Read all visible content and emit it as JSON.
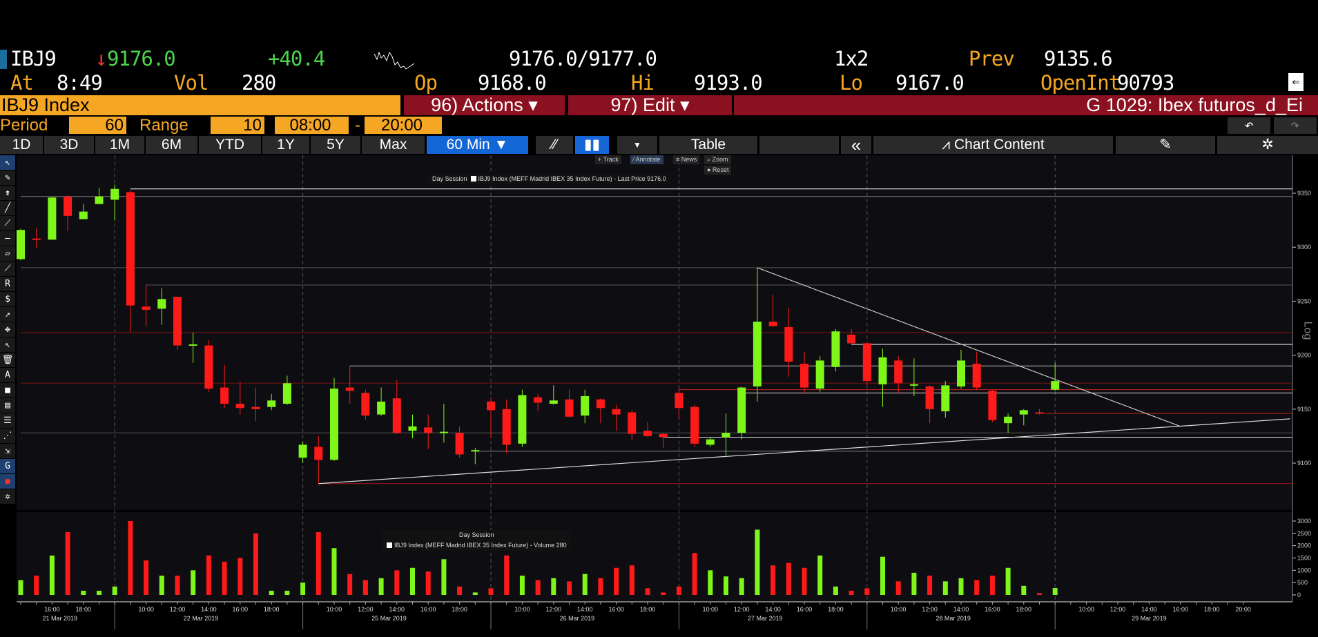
{
  "quote": {
    "ticker": "IBJ9",
    "arrow": "↓",
    "last": "9176.0",
    "change": "+40.4",
    "bid_ask": "9176.0/9177.0",
    "size": "1x2",
    "prev_label": "Prev",
    "prev": "9135.6",
    "at_label": "At",
    "time": "8:49",
    "vol_label": "Vol",
    "vol": "280",
    "op_label": "Op",
    "op": "9168.0",
    "hi_label": "Hi",
    "hi": "9193.0",
    "lo_label": "Lo",
    "lo": "9167.0",
    "oi_label": "OpenInt",
    "oi": "90793"
  },
  "bar": {
    "security": "IBJ9 Index",
    "actions": "96) Actions ▾",
    "edit": "97) Edit ▾",
    "title": "G 1029: Ibex futuros_d_Ei"
  },
  "params": {
    "period_label": "Period",
    "period": "60",
    "range_label": "Range",
    "range": "10",
    "start": "08:00",
    "dash": "-",
    "end": "20:00"
  },
  "toolbar": {
    "ranges": [
      "1D",
      "3D",
      "1M",
      "6M",
      "YTD",
      "1Y",
      "5Y",
      "Max"
    ],
    "interval": "60 Min ▼",
    "table": "Table",
    "collapse": "«",
    "chart_content": "Chart Content"
  },
  "chart_tools": {
    "track": "+ Track",
    "annotate": "⁄ Annotate",
    "news": "≡ News",
    "zoom": "⌕ Zoom",
    "reset": "● Reset"
  },
  "chart_data": {
    "type": "candlestick",
    "legend": {
      "session": "Day Session",
      "series": "IBJ9 Index (MEFF Madrid IBEX 35 Index Future) - Last Price 9176.0"
    },
    "volume_legend": {
      "session": "Day Session",
      "series": "IBJ9 Index (MEFF Madrid IBEX 35 Index Future) - Volume 280"
    },
    "y_axis_label": "Log",
    "ylim": [
      9060,
      9365
    ],
    "y_ticks": [
      "9350",
      "9300",
      "9250",
      "9200",
      "9150",
      "9100"
    ],
    "volume_ticks": [
      "3000",
      "2500",
      "2000",
      "1500",
      "1000",
      "500",
      "0"
    ],
    "colors": {
      "up": "#7ef61a",
      "down": "#ff1a1a"
    },
    "days": [
      {
        "date": "21 Mar 2019",
        "start": 0,
        "first_hour": 14,
        "count": 6,
        "labels": [
          "16:00",
          "18:00"
        ]
      },
      {
        "date": "22 Mar 2019",
        "start": 6,
        "first_hour": 8,
        "count": 12,
        "labels": [
          "10:00",
          "12:00",
          "14:00",
          "16:00",
          "18:00"
        ]
      },
      {
        "date": "25 Mar 2019",
        "start": 18,
        "first_hour": 8,
        "count": 12,
        "labels": [
          "10:00",
          "12:00",
          "14:00",
          "16:00",
          "18:00"
        ]
      },
      {
        "date": "26 Mar 2019",
        "start": 30,
        "first_hour": 8,
        "count": 12,
        "labels": [
          "10:00",
          "12:00",
          "14:00",
          "16:00",
          "18:00"
        ]
      },
      {
        "date": "27 Mar 2019",
        "start": 42,
        "first_hour": 8,
        "count": 12,
        "labels": [
          "10:00",
          "12:00",
          "14:00",
          "16:00",
          "18:00"
        ]
      },
      {
        "date": "28 Mar 2019",
        "start": 54,
        "first_hour": 8,
        "count": 12,
        "labels": [
          "10:00",
          "12:00",
          "14:00",
          "16:00",
          "18:00"
        ]
      },
      {
        "date": "29 Mar 2019",
        "start": 66,
        "first_hour": 8,
        "count": 13,
        "labels": [
          "10:00",
          "12:00",
          "14:00",
          "16:00",
          "18:00",
          "20:00"
        ]
      }
    ],
    "ohlc": [
      [
        9289,
        9317,
        9288,
        9316
      ],
      [
        9308,
        9318,
        9299,
        9307
      ],
      [
        9307,
        9347,
        9307,
        9346
      ],
      [
        9347,
        9348,
        9315,
        9329
      ],
      [
        9326,
        9340,
        9326,
        9333
      ],
      [
        9340,
        9355,
        9340,
        9347
      ],
      [
        9344,
        9358,
        9325,
        9354
      ],
      [
        9351,
        9353,
        9221,
        9246
      ],
      [
        9245,
        9265,
        9227,
        9242
      ],
      [
        9243,
        9262,
        9228,
        9252
      ],
      [
        9254,
        9254,
        9205,
        9209
      ],
      [
        9209,
        9221,
        9193,
        9210
      ],
      [
        9209,
        9214,
        9166,
        9169
      ],
      [
        9170,
        9191,
        9151,
        9155
      ],
      [
        9155,
        9175,
        9145,
        9151
      ],
      [
        9152,
        9170,
        9139,
        9150
      ],
      [
        9152,
        9164,
        9149,
        9158
      ],
      [
        9155,
        9181,
        9154,
        9174
      ],
      [
        9105,
        9120,
        9100,
        9117
      ],
      [
        9115,
        9125,
        9081,
        9103
      ],
      [
        9103,
        9179,
        9102,
        9169
      ],
      [
        9170,
        9190,
        9155,
        9167
      ],
      [
        9165,
        9168,
        9140,
        9144
      ],
      [
        9145,
        9170,
        9144,
        9157
      ],
      [
        9160,
        9177,
        9127,
        9128
      ],
      [
        9130,
        9145,
        9123,
        9134
      ],
      [
        9133,
        9145,
        9113,
        9128
      ],
      [
        9128,
        9155,
        9119,
        9129
      ],
      [
        9128,
        9134,
        9105,
        9108
      ],
      [
        9112,
        9114,
        9099,
        9112
      ],
      [
        9157,
        9160,
        9123,
        9149
      ],
      [
        9150,
        9159,
        9109,
        9117
      ],
      [
        9118,
        9168,
        9115,
        9163
      ],
      [
        9161,
        9164,
        9148,
        9156
      ],
      [
        9155,
        9172,
        9154,
        9158
      ],
      [
        9159,
        9168,
        9142,
        9143
      ],
      [
        9144,
        9168,
        9137,
        9162
      ],
      [
        9159,
        9160,
        9137,
        9151
      ],
      [
        9150,
        9154,
        9130,
        9145
      ],
      [
        9147,
        9149,
        9121,
        9127
      ],
      [
        9130,
        9138,
        9124,
        9125
      ],
      [
        9127,
        9128,
        9114,
        9124
      ],
      [
        9165,
        9170,
        9140,
        9151
      ],
      [
        9152,
        9154,
        9115,
        9118
      ],
      [
        9117,
        9124,
        9115,
        9122
      ],
      [
        9124,
        9146,
        9107,
        9128
      ],
      [
        9128,
        9171,
        9122,
        9170
      ],
      [
        9171,
        9281,
        9157,
        9231
      ],
      [
        9231,
        9256,
        9226,
        9227
      ],
      [
        9226,
        9244,
        9180,
        9194
      ],
      [
        9192,
        9203,
        9164,
        9170
      ],
      [
        9169,
        9199,
        9166,
        9195
      ],
      [
        9189,
        9224,
        9185,
        9222
      ],
      [
        9219,
        9224,
        9210,
        9211
      ],
      [
        9211,
        9212,
        9172,
        9176
      ],
      [
        9173,
        9206,
        9152,
        9198
      ],
      [
        9195,
        9199,
        9165,
        9174
      ],
      [
        9172,
        9197,
        9162,
        9173
      ],
      [
        9171,
        9172,
        9137,
        9150
      ],
      [
        9148,
        9176,
        9142,
        9172
      ],
      [
        9171,
        9205,
        9169,
        9195
      ],
      [
        9192,
        9203,
        9168,
        9170
      ],
      [
        9167,
        9168,
        9138,
        9140
      ],
      [
        9137,
        9146,
        9128,
        9143
      ],
      [
        9145,
        9150,
        9135,
        9149
      ],
      [
        9147,
        9150,
        9145,
        9146
      ],
      [
        9168,
        9193,
        9167,
        9176
      ]
    ],
    "volume": [
      600,
      780,
      1600,
      2550,
      170,
      170,
      340,
      3000,
      1400,
      780,
      780,
      1000,
      1600,
      1350,
      1500,
      2500,
      170,
      170,
      500,
      2550,
      1900,
      850,
      600,
      680,
      1000,
      1100,
      950,
      1450,
      340,
      100,
      270,
      1600,
      780,
      600,
      680,
      550,
      850,
      680,
      1100,
      1200,
      270,
      100,
      340,
      1700,
      1000,
      750,
      680,
      2650,
      1200,
      1300,
      1100,
      1600,
      340,
      170,
      270,
      1550,
      550,
      900,
      780,
      550,
      680,
      600,
      780,
      1100,
      370,
      70,
      280
    ],
    "horizontal_levels": [
      {
        "price": 9354,
        "from": 7,
        "color": "#ffffff"
      },
      {
        "price": 9347,
        "from": 0,
        "color": "#777777"
      },
      {
        "price": 9281,
        "from": 0,
        "color": "#555555"
      },
      {
        "price": 9265,
        "from": 8,
        "color": "#555555"
      },
      {
        "price": 9221,
        "from": 0,
        "color": "#7a1010"
      },
      {
        "price": 9190,
        "from": 21,
        "color": "#bbbbbb"
      },
      {
        "price": 9174,
        "from": 0,
        "color": "#7a1010"
      },
      {
        "price": 9168,
        "from": 42,
        "color": "#cc2020"
      },
      {
        "price": 9165,
        "from": 46,
        "color": "#dddddd"
      },
      {
        "price": 9210,
        "from": 53,
        "color": "#ffffff"
      },
      {
        "price": 9146,
        "from": 65,
        "color": "#cc2020"
      },
      {
        "price": 9128,
        "from": 0,
        "color": "#555555"
      },
      {
        "price": 9124,
        "from": 41,
        "color": "#dddddd"
      },
      {
        "price": 9111,
        "from": 29,
        "color": "#888888"
      },
      {
        "price": 9081,
        "from": 19,
        "color": "#aa1515"
      }
    ],
    "trendlines": [
      {
        "from": [
          19,
          9081
        ],
        "to": [
          81,
          9141
        ],
        "color": "#dddddd"
      },
      {
        "from": [
          47,
          9281
        ],
        "to": [
          74,
          9134
        ],
        "color": "#cccccc"
      }
    ]
  }
}
